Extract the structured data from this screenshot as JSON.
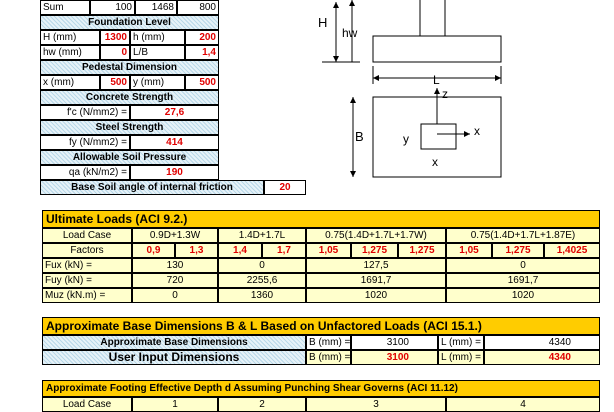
{
  "top": {
    "sum_label": "Sum",
    "sum_v1": "100",
    "sum_v2": "1468",
    "sum_v3": "800",
    "foundation_level_title": "Foundation Level",
    "H_label": "H (mm)",
    "H_value": "1300",
    "h_label": "h (mm)",
    "h_value": "200",
    "hw_label": "hw (mm)",
    "hw_value": "0",
    "LB_label": "L/B",
    "LB_value": "1,4",
    "pedestal_title": "Pedestal Dimension",
    "x_label": "x (mm)",
    "x_value": "500",
    "y_label": "y (mm)",
    "y_value": "500",
    "concrete_title": "Concrete Strength",
    "fc_label": "f'c (N/mm2) =",
    "fc_value": "27,6",
    "steel_title": "Steel Strength",
    "fy_label": "fy (N/mm2) =",
    "fy_value": "414",
    "soil_title": "Allowable Soil Pressure",
    "qa_label": "qa (kN/m2) =",
    "qa_value": "190",
    "friction_label": "Base Soil angle of internal friction",
    "friction_value": "20"
  },
  "diagram": {
    "H": "H",
    "hw": "hw",
    "L": "L",
    "B": "B",
    "z": "z",
    "x_axis": "x",
    "y_axis": "y",
    "x_below": "x"
  },
  "ultimate": {
    "title": "Ultimate Loads (ACI 9.2.)",
    "load_case_label": "Load Case",
    "cases": [
      "0.9D+1.3W",
      "1.4D+1.7L",
      "0.75(1.4D+1.7L+1.7W)",
      "0.75(1.4D+1.7L+1.87E)"
    ],
    "factors_label": "Factors",
    "factors": [
      [
        "0,9",
        "1,3"
      ],
      [
        "1,4",
        "1,7"
      ],
      [
        "1,05",
        "1,275",
        "1,275"
      ],
      [
        "1,05",
        "1,275",
        "1,4025"
      ]
    ],
    "rows": [
      {
        "label": "Fux (kN) =",
        "values": [
          "130",
          "0",
          "127,5",
          "0"
        ]
      },
      {
        "label": "Fuy (kN) =",
        "values": [
          "720",
          "2255,6",
          "1691,7",
          "1691,7"
        ]
      },
      {
        "label": "Muz (kN.m) =",
        "values": [
          "0",
          "1360",
          "1020",
          "1020"
        ]
      }
    ]
  },
  "approx": {
    "title": "Approximate Base Dimensions  B & L Based on Unfactored Loads (ACI 15.1.)",
    "row1_label": "Approximate Base Dimensions",
    "B_label": "B (mm) =",
    "B_value": "3100",
    "L_label": "L (mm) =",
    "L_value": "4340",
    "row2_label": "User Input Dimensions",
    "B2_label": "B (mm) =",
    "B2_value": "3100",
    "L2_label": "L (mm) =",
    "L2_value": "4340"
  },
  "depth": {
    "title": "Approximate Footing Effective Depth d Assuming Punching Shear Governs (ACI 11.12)",
    "load_case_label": "Load Case",
    "cols": [
      "1",
      "2",
      "3",
      "4"
    ]
  }
}
